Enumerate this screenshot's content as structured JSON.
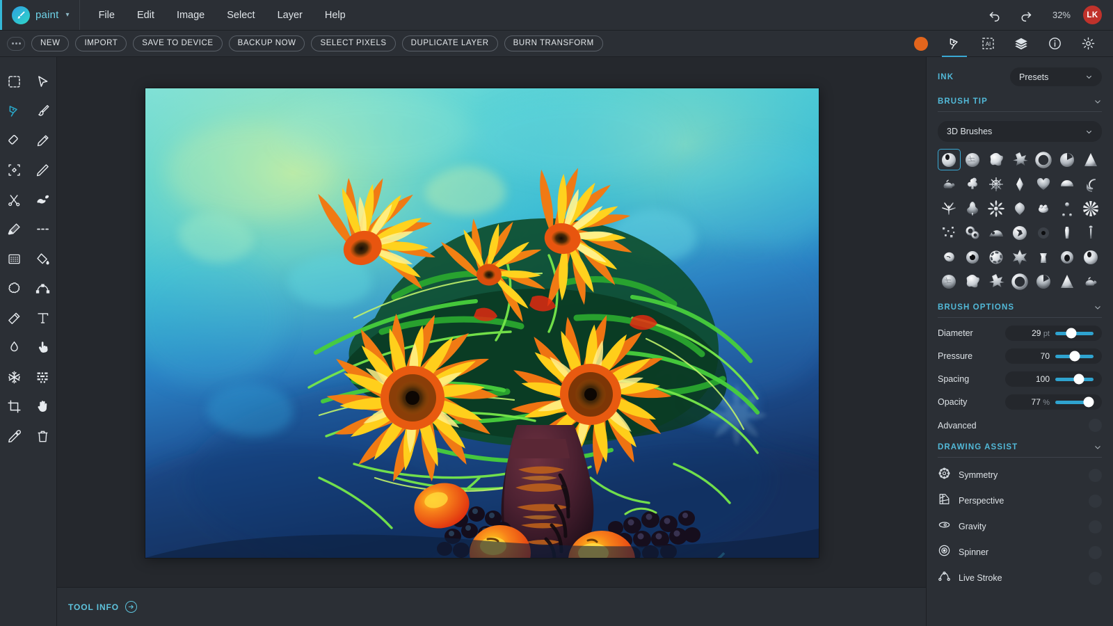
{
  "app": {
    "brand_name": "paint",
    "brand_caret": "▾",
    "logo_icon": "paintbrush-logo-icon"
  },
  "menubar": {
    "items": [
      {
        "label": "File"
      },
      {
        "label": "Edit"
      },
      {
        "label": "Image"
      },
      {
        "label": "Select"
      },
      {
        "label": "Layer"
      },
      {
        "label": "Help"
      }
    ],
    "undo_icon": "undo-arrow-icon",
    "redo_icon": "redo-arrow-icon",
    "zoom_level": "32%",
    "avatar_initials": "LK",
    "avatar_color": "#c0322b"
  },
  "actionbar": {
    "overflow_icon": "more-options-icon",
    "buttons": [
      {
        "label": "NEW"
      },
      {
        "label": "IMPORT"
      },
      {
        "label": "SAVE TO DEVICE"
      },
      {
        "label": "BACKUP NOW"
      },
      {
        "label": "SELECT PIXELS"
      },
      {
        "label": "DUPLICATE LAYER"
      },
      {
        "label": "BURN TRANSFORM"
      }
    ],
    "tabs": [
      {
        "name": "color-swatch",
        "icon": "color-swatch-icon",
        "active": false,
        "color": "#e3651c"
      },
      {
        "name": "brush-tool-tab",
        "icon": "pen-nib-icon",
        "active": true
      },
      {
        "name": "ai-select-tab",
        "icon": "ai-selection-icon",
        "active": false
      },
      {
        "name": "layers-tab",
        "icon": "layers-stack-icon",
        "active": false
      },
      {
        "name": "info-tab",
        "icon": "info-circle-icon",
        "active": false
      },
      {
        "name": "settings-tab",
        "icon": "gear-icon",
        "active": false
      }
    ]
  },
  "lefttools": {
    "tools": [
      {
        "name": "marquee-select-tool",
        "icon": "dashed-rectangle-icon",
        "active": false
      },
      {
        "name": "move-select-tool",
        "icon": "cursor-arrow-icon",
        "active": false
      },
      {
        "name": "pen-tool",
        "icon": "pen-nib-icon",
        "active": true
      },
      {
        "name": "paintbrush-tool",
        "icon": "paintbrush-icon",
        "active": false
      },
      {
        "name": "eraser-tool",
        "icon": "eraser-icon",
        "active": false
      },
      {
        "name": "pencil-tool",
        "icon": "pencil-icon",
        "active": false
      },
      {
        "name": "transform-tool",
        "icon": "transform-handles-icon",
        "active": false
      },
      {
        "name": "fine-pencil-tool",
        "icon": "fine-pencil-icon",
        "active": false
      },
      {
        "name": "scissors-tool",
        "icon": "scissors-icon",
        "active": false
      },
      {
        "name": "smudge-brush-tool",
        "icon": "smudge-brush-icon",
        "active": false
      },
      {
        "name": "marker-tool",
        "icon": "marker-icon",
        "active": false
      },
      {
        "name": "dashed-line-tool",
        "icon": "dashed-line-icon",
        "active": false
      },
      {
        "name": "pattern-tool",
        "icon": "pattern-grid-icon",
        "active": false
      },
      {
        "name": "paint-bucket-tool",
        "icon": "paint-bucket-icon",
        "active": false
      },
      {
        "name": "blob-shape-tool",
        "icon": "blob-shape-icon",
        "active": false
      },
      {
        "name": "bezier-curve-tool",
        "icon": "bezier-curve-icon",
        "active": false
      },
      {
        "name": "blur-stick-tool",
        "icon": "blur-stick-icon",
        "active": false
      },
      {
        "name": "text-tool",
        "icon": "text-t-icon",
        "active": false
      },
      {
        "name": "water-drop-tool",
        "icon": "water-drop-icon",
        "active": false
      },
      {
        "name": "pointer-hand-tool",
        "icon": "pointing-hand-icon",
        "active": false
      },
      {
        "name": "snowflake-tool",
        "icon": "snowflake-icon",
        "active": false
      },
      {
        "name": "dither-tool",
        "icon": "dither-grid-icon",
        "active": false
      },
      {
        "name": "crop-tool",
        "icon": "crop-icon",
        "active": false
      },
      {
        "name": "pan-hand-tool",
        "icon": "open-hand-icon",
        "active": false
      },
      {
        "name": "eyedropper-tool",
        "icon": "eyedropper-icon",
        "active": false
      },
      {
        "name": "delete-tool",
        "icon": "trash-can-icon",
        "active": false
      }
    ]
  },
  "statusbar": {
    "tool_info_label": "TOOL INFO",
    "tool_info_icon": "arrow-right-circle-icon"
  },
  "rightpanel": {
    "collapse_icon": "chevron-right-icon",
    "ink": {
      "title": "INK",
      "preset_value": "Presets",
      "caret_icon": "chevron-down-icon"
    },
    "brush_tip": {
      "title": "BRUSH TIP",
      "caret_icon": "chevron-down-icon",
      "category_value": "3D Brushes",
      "selected_index": 0,
      "tips": [
        "sphere-notch-tip",
        "crumpled-ball-tip",
        "splat-blob-tip",
        "star-burst-tip",
        "ring-torus-tip",
        "pac-sphere-tip",
        "cone-tip",
        "teapot-tip",
        "club-suit-tip",
        "spiked-ball-tip",
        "diamond-tip",
        "heart-tip",
        "shell-cap-tip",
        "ornament-scroll-tip",
        "grass-tuft-tip",
        "spade-suit-tip",
        "dandelion-tip",
        "crumple-flower-tip",
        "frog-tip",
        "jack-tip",
        "splash-tip",
        "confetti-dots-tip",
        "rings-cluster-tip",
        "bridge-tip",
        "cracked-rock-tip",
        "soft-blur-dot-tip",
        "gingerbread-tip",
        "smooth-disc-tip",
        "rock-chunk-tip",
        "tiny-figure-tip",
        "match-stick-tip",
        "thin-needle-tip",
        "star-rock-tip",
        "pin-tip",
        "lamp-tip",
        "goblet-tip",
        "eye-orb-tip",
        "dark-orb-tip",
        "pearl-orb-tip",
        "golf-ball-tip",
        "spiky-star-tip",
        "jagged-burst-tip"
      ]
    },
    "brush_options": {
      "title": "BRUSH OPTIONS",
      "caret_icon": "chevron-down-icon",
      "sliders": [
        {
          "label": "Diameter",
          "value": "29",
          "unit": "pt",
          "percent": 42
        },
        {
          "label": "Pressure",
          "value": "70",
          "unit": "",
          "percent": 51
        },
        {
          "label": "Spacing",
          "value": "100",
          "unit": "",
          "percent": 61
        },
        {
          "label": "Opacity",
          "value": "77",
          "unit": "%",
          "percent": 87
        }
      ],
      "advanced_label": "Advanced",
      "advanced_toggle": "advanced-toggle"
    },
    "drawing_assist": {
      "title": "DRAWING ASSIST",
      "caret_icon": "chevron-down-icon",
      "items": [
        {
          "label": "Symmetry",
          "icon": "symmetry-icon"
        },
        {
          "label": "Perspective",
          "icon": "perspective-grid-icon"
        },
        {
          "label": "Gravity",
          "icon": "gravity-eye-icon"
        },
        {
          "label": "Spinner",
          "icon": "spinner-target-icon"
        },
        {
          "label": "Live Stroke",
          "icon": "live-stroke-node-icon"
        }
      ]
    }
  },
  "canvas": {
    "artwork_title": "sunflower-still-life-painting",
    "description": "Impressionist digital painting of a sunflower bouquet in a dark maroon vase with oranges and dark grapes on a turquoise and blue background",
    "palette": {
      "background_top": "#4ec8d8",
      "background_bottom": "#1b3a6b",
      "petal_yellow": "#ffd21e",
      "petal_orange": "#f07a14",
      "leaf_green": "#3dc23a",
      "vase_maroon": "#4a2230",
      "fruit_orange": "#f0461a",
      "grape_dark": "#1b1220"
    }
  }
}
